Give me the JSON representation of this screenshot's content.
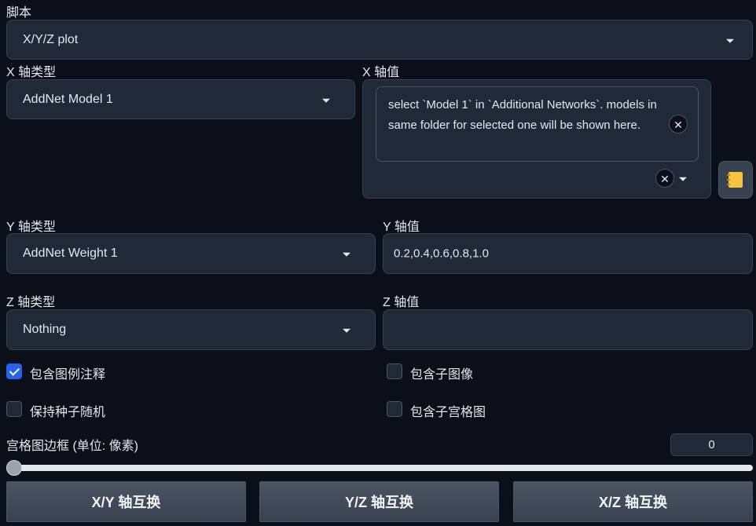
{
  "script": {
    "label": "脚本",
    "value": "X/Y/Z plot"
  },
  "x_axis": {
    "type_label": "X 轴类型",
    "type_value": "AddNet Model 1",
    "values_label": "X 轴值",
    "tag_text": "select `Model 1` in `Additional Networks`. models in same folder for selected one will be shown here."
  },
  "y_axis": {
    "type_label": "Y 轴类型",
    "type_value": "AddNet Weight 1",
    "values_label": "Y 轴值",
    "values": "0.2,0.4,0.6,0.8,1.0"
  },
  "z_axis": {
    "type_label": "Z 轴类型",
    "type_value": "Nothing",
    "values_label": "Z 轴值",
    "values": ""
  },
  "options": {
    "include_legend": {
      "label": "包含图例注释",
      "checked": true
    },
    "include_sub_images": {
      "label": "包含子图像",
      "checked": false
    },
    "keep_seed": {
      "label": "保持种子随机",
      "checked": false
    },
    "include_sub_grids": {
      "label": "包含子宫格图",
      "checked": false
    }
  },
  "margin": {
    "label": "宫格图边框 (单位: 像素)",
    "value": "0",
    "slider_value": 0
  },
  "swap_buttons": {
    "xy": "X/Y 轴互换",
    "yz": "Y/Z 轴互换",
    "xz": "X/Z 轴互换"
  },
  "colors": {
    "accent": "#2563eb",
    "background": "#0b0f19",
    "field": "#1f2937",
    "notebook_icon": "#f5c542"
  },
  "icons": {
    "clear": "close-icon",
    "dropdown": "chevron-down-icon",
    "notebook": "notebook-icon"
  }
}
